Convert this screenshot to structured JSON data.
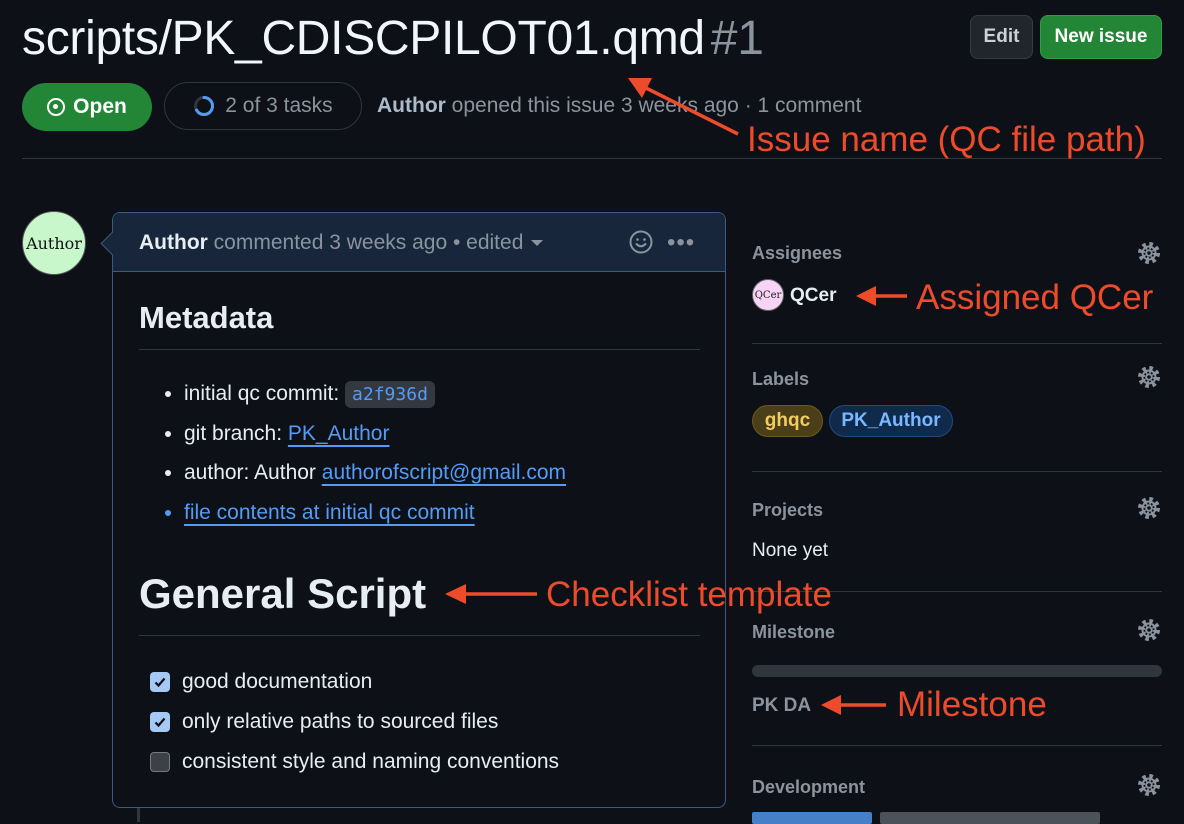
{
  "header": {
    "title": "scripts/PK_CDISCPILOT01.qmd",
    "number": "#1",
    "edit_label": "Edit",
    "new_issue_label": "New issue",
    "state_label": "Open",
    "tasks_label": "2 of 3 tasks",
    "tasks_progress": 0.667,
    "author": "Author",
    "opened_text": "opened this issue 3 weeks ago · 1 comment"
  },
  "comment": {
    "avatar_text": "Author",
    "author": "Author",
    "header_text": "commented 3 weeks ago • edited",
    "metadata_heading": "Metadata",
    "items": {
      "commit_label": "initial qc commit: ",
      "commit_sha": "a2f936d",
      "branch_label": "git branch: ",
      "branch_link": "PK_Author",
      "author_label": "author: Author ",
      "author_email": "authorofscript@gmail.com",
      "file_link": "file contents at initial qc commit"
    },
    "checklist_heading": "General Script",
    "checklist": [
      {
        "text": "good documentation",
        "checked": true
      },
      {
        "text": "only relative paths to sourced files",
        "checked": true
      },
      {
        "text": "consistent style and naming conventions",
        "checked": false
      }
    ]
  },
  "sidebar": {
    "assignees_title": "Assignees",
    "assignee_avatar_text": "QCer",
    "assignee_name": "QCer",
    "labels_title": "Labels",
    "labels": [
      "ghqc",
      "PK_Author"
    ],
    "projects_title": "Projects",
    "projects_value": "None yet",
    "milestone_title": "Milestone",
    "milestone_value": "PK DA",
    "development_title": "Development"
  },
  "annotations": {
    "issue_name": "Issue name (QC file path)",
    "assigned_qcer": "Assigned QCer",
    "checklist_template": "Checklist template",
    "milestone": "Milestone"
  },
  "colors": {
    "background": "#0d1117",
    "open_green": "#238636",
    "link_blue": "#539bf5",
    "annotation_red": "#ee4b2b"
  }
}
